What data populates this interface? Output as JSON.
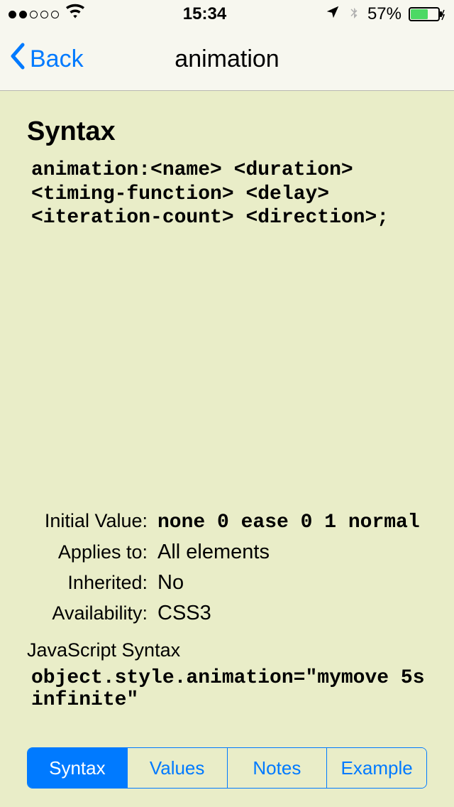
{
  "status": {
    "time": "15:34",
    "battery_pct": "57%"
  },
  "nav": {
    "back": "Back",
    "title": "animation"
  },
  "content": {
    "syntax_heading": "Syntax",
    "syntax_code": "animation:<name> <duration> <timing-function> <delay> <iteration-count> <direction>;",
    "properties": [
      {
        "label": "Initial Value:",
        "value": "none 0 ease 0 1 normal",
        "mono": true
      },
      {
        "label": "Applies to:",
        "value": "All elements",
        "mono": false
      },
      {
        "label": "Inherited:",
        "value": "No",
        "mono": false
      },
      {
        "label": "Availability:",
        "value": "CSS3",
        "mono": false
      }
    ],
    "js_syntax_label": "JavaScript Syntax",
    "js_syntax_code": "object.style.animation=\"mymove 5s infinite\""
  },
  "tabs": [
    {
      "label": "Syntax",
      "active": true
    },
    {
      "label": "Values",
      "active": false
    },
    {
      "label": "Notes",
      "active": false
    },
    {
      "label": "Example",
      "active": false
    }
  ]
}
